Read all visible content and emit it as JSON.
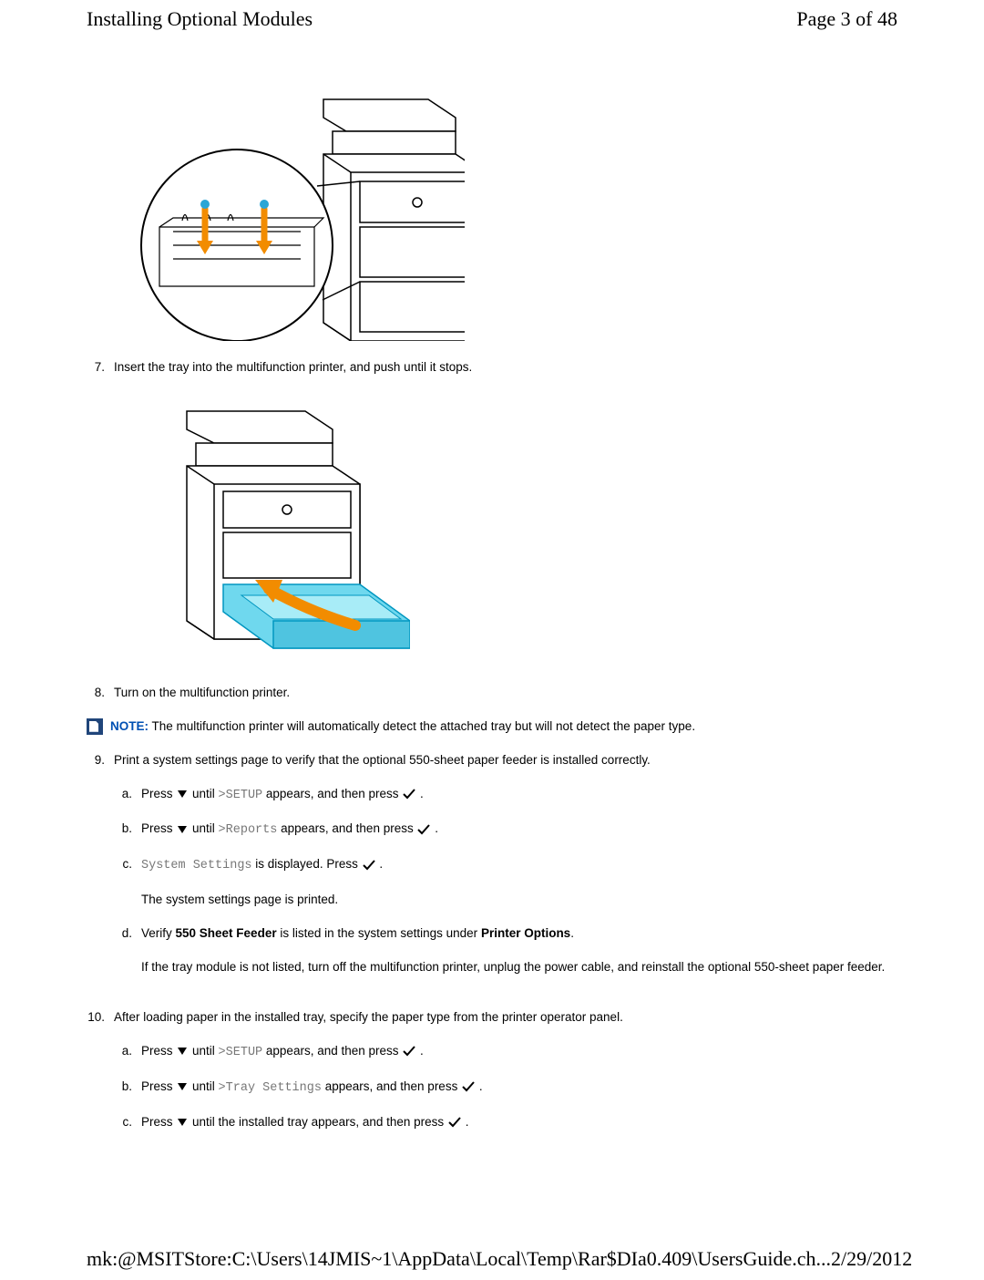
{
  "header": {
    "title": "Installing Optional Modules",
    "page_indicator": "Page 3 of 48"
  },
  "steps": {
    "s7": {
      "num": "7.",
      "text": "Insert the tray into the multifunction printer, and push until it stops."
    },
    "s8": {
      "num": "8.",
      "text": "Turn on the multifunction printer."
    },
    "note": {
      "label": "NOTE:",
      "text": " The multifunction printer will automatically detect the attached tray but will not detect the paper type."
    },
    "s9": {
      "num": "9.",
      "text": "Print a system settings page to verify that the optional 550-sheet paper feeder is installed correctly.",
      "a": {
        "num": "a.",
        "press": "Press ",
        "until": " until ",
        "code": ">SETUP",
        "appears": " appears, and then press ",
        "dot": " ."
      },
      "b": {
        "num": "b.",
        "press": "Press ",
        "until": " until ",
        "code": ">Reports",
        "appears": " appears, and then press ",
        "dot": " ."
      },
      "c": {
        "num": "c.",
        "code": "System Settings",
        "disp": " is displayed. Press ",
        "dot": " .",
        "extra": "The system settings page is printed."
      },
      "d": {
        "num": "d.",
        "verify": "Verify ",
        "bold1": "550 Sheet Feeder",
        "mid": " is listed in the system settings under ",
        "bold2": "Printer Options",
        "dot": ".",
        "extra": "If the tray module is not listed, turn off the multifunction printer, unplug the power cable, and reinstall the optional 550-sheet paper feeder."
      }
    },
    "s10": {
      "num": "10.",
      "text": "After loading paper in the installed tray, specify the paper type from the printer operator panel.",
      "a": {
        "num": "a.",
        "press": "Press ",
        "until": " until ",
        "code": ">SETUP",
        "appears": " appears, and then press ",
        "dot": " ."
      },
      "b": {
        "num": "b.",
        "press": "Press ",
        "until": " until ",
        "code": ">Tray Settings",
        "appears": " appears, and then press ",
        "dot": " ."
      },
      "c": {
        "num": "c.",
        "press": "Press ",
        "until": " until the installed tray appears, and then press ",
        "dot": " ."
      }
    }
  },
  "footer": {
    "path": "mk:@MSITStore:C:\\Users\\14JMIS~1\\AppData\\Local\\Temp\\Rar$DIa0.409\\UsersGuide.ch...",
    "date": "2/29/2012"
  }
}
